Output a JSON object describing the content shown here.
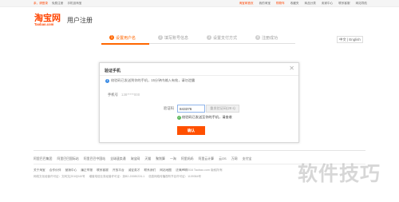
{
  "topbar": {
    "greeting": "亲，请登录",
    "free_register": "免费注册",
    "mobile_taobao": "手机逛淘宝",
    "right_links": [
      "淘宝网首页",
      "我的淘宝",
      "购物车",
      "收藏夹",
      "商品分类",
      "卖家中心",
      "联系客服",
      "网站导航"
    ],
    "accent_color": "#ff4400"
  },
  "header": {
    "logo_cn": "淘宝网",
    "logo_en": "Taobao.com",
    "page_title": "用户注册"
  },
  "steps": {
    "items": [
      {
        "num": "1",
        "label": "设置用户名",
        "active": true
      },
      {
        "num": "2",
        "label": "填写账号信息",
        "active": false
      },
      {
        "num": "3",
        "label": "设置支付方式",
        "active": false
      },
      {
        "num": "4",
        "label": "注册成功",
        "active": false
      }
    ],
    "language_switch": "中文 | English"
  },
  "dialog": {
    "title": "验证手机",
    "close_icon": "close-icon",
    "notice": "校验码已发送到你的手机，15分钟内输入有效，请勿泄露",
    "phone_label": "手机号",
    "phone_value": "138*****000",
    "code_label": "验证码",
    "code_value": "843376",
    "resend_label": "重发验证码(28 s)",
    "sent_hint": "校验码已发送至你的手机，请查收",
    "confirm_label": "确认"
  },
  "footer": {
    "links": [
      "阿里巴巴集团",
      "阿里巴巴国际站",
      "阿里巴巴中国站",
      "全球速卖通",
      "淘宝网",
      "天猫",
      "聚划算",
      "一淘",
      "阿里妈妈",
      "阿里云计算",
      "云OS",
      "万网",
      "支付宝"
    ],
    "about_links": [
      "关于淘宝",
      "合作伙伴",
      "营销中心",
      "廉正举报",
      "联系客服",
      "开放平台",
      "诚征英才",
      "联系我们",
      "网站地图",
      "法律声明"
    ],
    "copyright": "© 2016 Taobao.com 版权所有",
    "license": [
      "网络文化经营许可证：文网文[2010]040号",
      "增值电信业务经营许可证：浙B2-20080224-1",
      "信息网络传播视听节目许可证：1109364号"
    ]
  },
  "watermark": "软件技巧"
}
